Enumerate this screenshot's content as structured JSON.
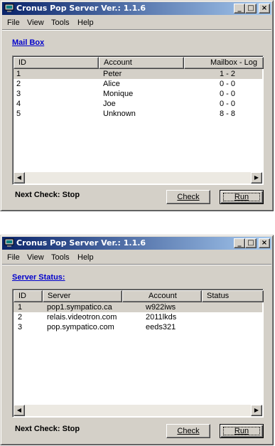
{
  "window1": {
    "title": "Cronus Pop Server Ver.: 1.1.6",
    "menu": [
      "File",
      "View",
      "Tools",
      "Help"
    ],
    "section_link": "Mail Box",
    "columns": [
      "ID",
      "Account",
      "Mailbox - Log"
    ],
    "rows": [
      {
        "id": "1",
        "account": "Peter",
        "log": "1 - 2",
        "selected": true
      },
      {
        "id": "2",
        "account": "Alice",
        "log": "0 - 0"
      },
      {
        "id": "3",
        "account": "Monique",
        "log": "0 - 0"
      },
      {
        "id": "4",
        "account": "Joe",
        "log": "0 - 0"
      },
      {
        "id": "5",
        "account": "Unknown",
        "log": "8 - 8"
      }
    ],
    "status": "Next Check: Stop",
    "check_label": "Check",
    "run_label": "Run"
  },
  "window2": {
    "title": "Cronus Pop Server Ver.: 1.1.6",
    "menu": [
      "File",
      "View",
      "Tools",
      "Help"
    ],
    "section_link": "Server Status:",
    "columns": [
      "ID",
      "Server",
      "Account",
      "Status"
    ],
    "rows": [
      {
        "id": "1",
        "server": "pop1.sympatico.ca",
        "account": "w922iws",
        "status": "",
        "selected": true
      },
      {
        "id": "2",
        "server": "relais.videotron.com",
        "account": "2011lkds",
        "status": ""
      },
      {
        "id": "3",
        "server": "pop.sympatico.com",
        "account": "eeds321",
        "status": ""
      }
    ],
    "status": "Next Check: Stop",
    "check_label": "Check",
    "run_label": "Run"
  },
  "titlebar_buttons": {
    "minimize": "_",
    "maximize": "□",
    "close": "×"
  },
  "scroll_arrows": {
    "left": "◀",
    "right": "▶"
  }
}
